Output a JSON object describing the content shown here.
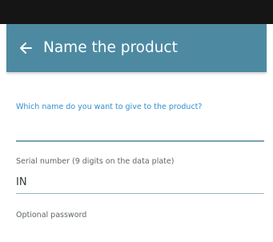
{
  "header": {
    "back_icon": "arrow-left-icon",
    "title": "Name the product"
  },
  "form": {
    "name_field": {
      "label": "Which name do you want to give to the product?",
      "value": ""
    },
    "serial_field": {
      "label": "Serial number (9 digits on the data plate)",
      "value": "IN"
    },
    "password_field": {
      "label": "Optional password"
    }
  },
  "colors": {
    "status_bar": "#151515",
    "app_bar": "#4d8aa2",
    "focused_label": "#2f8fd0",
    "label": "#5f6669"
  }
}
